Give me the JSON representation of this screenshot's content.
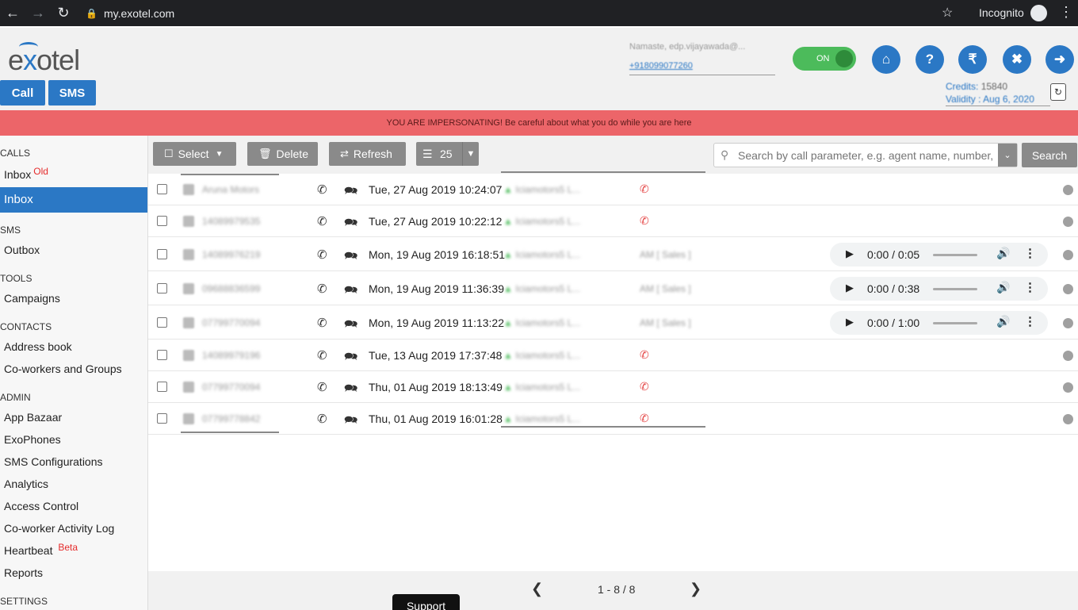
{
  "browser": {
    "url": "my.exotel.com",
    "mode_label": "Incognito"
  },
  "header": {
    "logo_text_e": "e",
    "logo_text_x": "x",
    "logo_text_rest": "otel",
    "user_greeting": "Namaste, edp.vijayawada@...",
    "user_number": "+918099077260",
    "toggle_label": "ON",
    "call_button": "Call",
    "sms_button": "SMS",
    "credits_label": "Credits:",
    "credits_value": "15840",
    "validity_label": "Validity :",
    "validity_value": "Aug 6, 2020"
  },
  "banner": {
    "text": "YOU ARE IMPERSONATING! Be careful about what you do while you are here"
  },
  "sidebar": {
    "calls_head": "CALLS",
    "inbox_old": "Inbox",
    "inbox_old_tag": "Old",
    "inbox": "Inbox",
    "sms_head": "SMS",
    "outbox": "Outbox",
    "tools_head": "TOOLS",
    "campaigns": "Campaigns",
    "contacts_head": "CONTACTS",
    "address_book": "Address book",
    "coworkers": "Co-workers and Groups",
    "admin_head": "ADMIN",
    "app_bazaar": "App Bazaar",
    "exophones": "ExoPhones",
    "sms_config": "SMS Configurations",
    "analytics": "Analytics",
    "access_control": "Access Control",
    "activity_log": "Co-worker Activity Log",
    "heartbeat": "Heartbeat",
    "heartbeat_tag": "Beta",
    "reports": "Reports",
    "settings_head": "SETTINGS"
  },
  "toolbar": {
    "select": "Select",
    "delete": "Delete",
    "refresh": "Refresh",
    "page_size": "25",
    "search_placeholder": "Search by call parameter, e.g. agent name, number, etc.",
    "search_button": "Search"
  },
  "rows": [
    {
      "name": "Aruna Motors",
      "datetime": "Tue, 27 Aug 2019 10:24:07",
      "agent": "Iciamotors5 L...",
      "status": "",
      "audio": ""
    },
    {
      "name": "14089979535",
      "datetime": "Tue, 27 Aug 2019 10:22:12",
      "agent": "Iciamotors5 L...",
      "status": "",
      "audio": ""
    },
    {
      "name": "14089976219",
      "datetime": "Mon, 19 Aug 2019 16:18:51",
      "agent": "Iciamotors5 L...",
      "status": "AM [ Sales ]",
      "audio": "0:00 / 0:05"
    },
    {
      "name": "09688836599",
      "datetime": "Mon, 19 Aug 2019 11:36:39",
      "agent": "Iciamotors5 L...",
      "status": "AM [ Sales ]",
      "audio": "0:00 / 0:38"
    },
    {
      "name": "07799770094",
      "datetime": "Mon, 19 Aug 2019 11:13:22",
      "agent": "Iciamotors5 L...",
      "status": "AM [ Sales ]",
      "audio": "0:00 / 1:00"
    },
    {
      "name": "14089979196",
      "datetime": "Tue, 13 Aug 2019 17:37:48",
      "agent": "Iciamotors5 L...",
      "status": "",
      "audio": ""
    },
    {
      "name": "07799770094",
      "datetime": "Thu, 01 Aug 2019 18:13:49",
      "agent": "Iciamotors5 L...",
      "status": "",
      "audio": ""
    },
    {
      "name": "07799778842",
      "datetime": "Thu, 01 Aug 2019 16:01:28",
      "agent": "Iciamotors5 L...",
      "status": "",
      "audio": ""
    }
  ],
  "footer": {
    "page_info": "1 - 8 / 8",
    "support": "Support"
  },
  "colors": {
    "accent": "#2b78c5",
    "banner": "#ec6569",
    "toggle": "#4cbb5b",
    "button_grey": "#8a8a8a"
  }
}
